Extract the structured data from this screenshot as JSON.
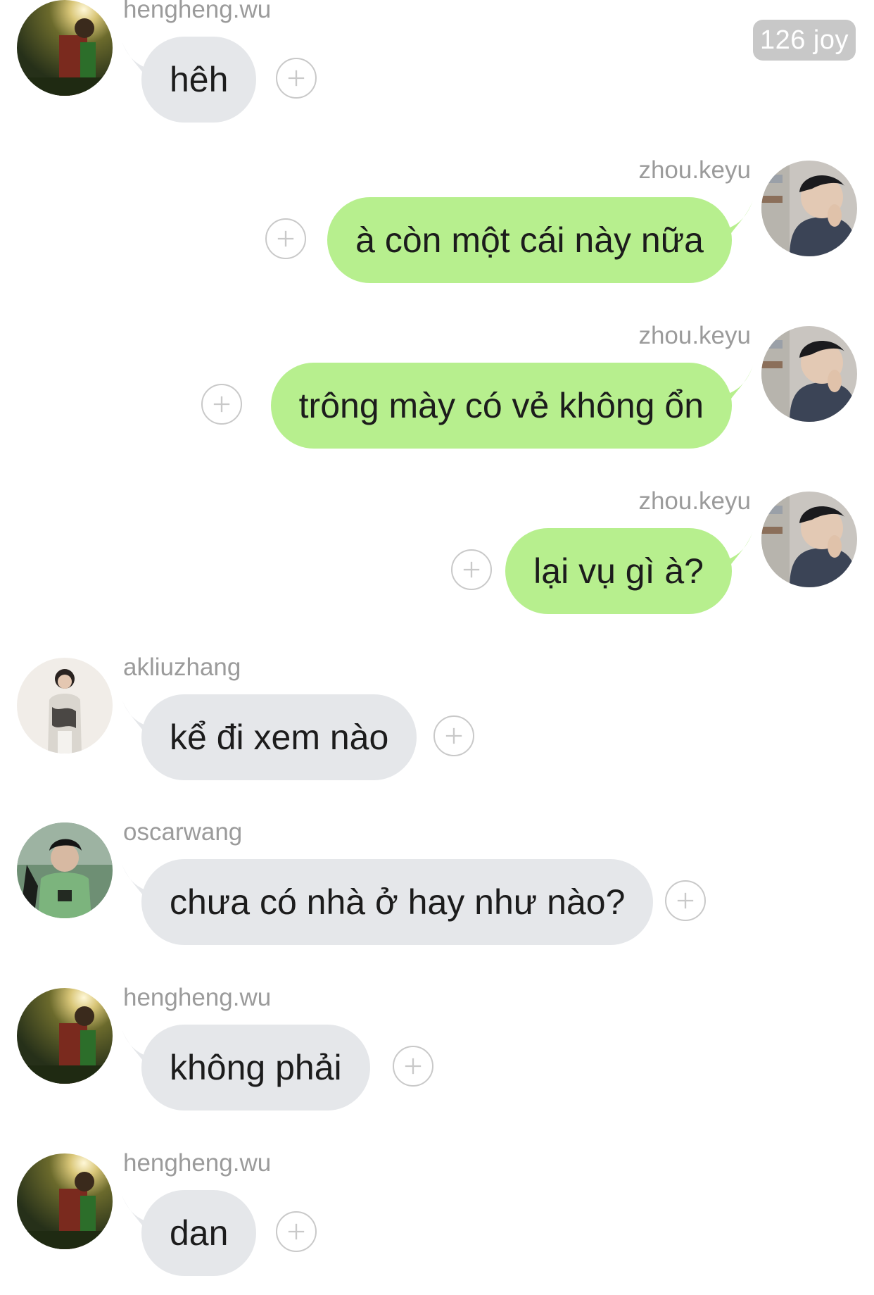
{
  "header": {
    "joy_count": "126 joy"
  },
  "messages": [
    {
      "user": "hengheng.wu",
      "text": "hêh",
      "side": "incoming",
      "avatar": "hengheng-avatar"
    },
    {
      "user": "zhou.keyu",
      "text": "à còn một cái này nữa",
      "side": "outgoing",
      "avatar": "zhoukeyu-avatar"
    },
    {
      "user": "zhou.keyu",
      "text": "trông mày có vẻ không ổn",
      "side": "outgoing",
      "avatar": "zhoukeyu-avatar"
    },
    {
      "user": "zhou.keyu",
      "text": "lại vụ gì à?",
      "side": "outgoing",
      "avatar": "zhoukeyu-avatar"
    },
    {
      "user": "akliuzhang",
      "text": "kể đi xem nào",
      "side": "incoming",
      "avatar": "akliuzhang-avatar"
    },
    {
      "user": "oscarwang",
      "text": "chưa có nhà ở hay như nào?",
      "side": "incoming",
      "avatar": "oscarwang-avatar"
    },
    {
      "user": "hengheng.wu",
      "text": "không phải",
      "side": "incoming",
      "avatar": "hengheng-avatar"
    },
    {
      "user": "hengheng.wu",
      "text": "dan",
      "side": "incoming",
      "avatar": "hengheng-avatar"
    }
  ],
  "icons": {
    "add_reaction": "plus-circle-icon"
  },
  "colors": {
    "incoming_bubble": "#e5e7ea",
    "outgoing_bubble": "#b7ef8e",
    "username": "#9b9b9b",
    "badge": "#c8c8c8"
  }
}
